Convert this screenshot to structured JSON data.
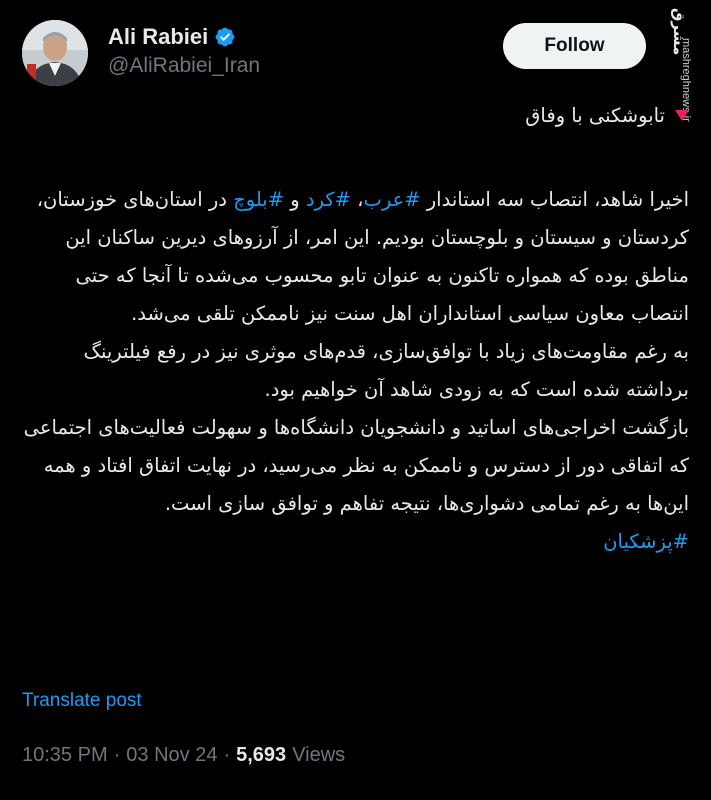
{
  "header": {
    "name": "Ali Rabiei",
    "handle": "@AliRabiei_Iran",
    "follow_label": "Follow",
    "verified": true
  },
  "watermark": {
    "logo": "مشرق",
    "site": "mashreghnews.ir"
  },
  "post": {
    "title": "تابوشکنی با وفاق",
    "paragraphs": [
      [
        "اخیرا شاهد، انتصاب سه استاندار ",
        {
          "tag": "#عرب"
        },
        "، ",
        {
          "tag": "#کرد"
        },
        " و ",
        {
          "tag": "#بلوچ"
        },
        " در استان‌های خوزستان، کردستان و سیستان و بلوچستان بودیم. این امر، از آرزوهای دیرین ساکنان این مناطق بوده که همواره تاکنون به عنوان تابو محسوب می‌شده تا آنجا که حتی انتصاب معاون سیاسی استانداران اهل سنت نیز ناممکن تلقی می‌شد."
      ],
      [
        "به رغم مقاومت‌های زیاد با توافق‌سازی، قدم‌های موثری نیز در رفع فیلترینگ  برداشته شده است که به زودی شاهد آن خواهیم بود."
      ],
      [
        "بازگشت اخراجی‌های اساتید و دانشجویان دانشگاه‌ها و سهولت فعالیت‌های اجتماعی که  اتفاقی دور از دسترس و ناممکن به نظر می‌رسید، در نهایت اتفاق افتاد و همه این‌ها به رغم تمامی دشواری‌ها، نتیجه تفاهم و توافق سازی است."
      ],
      [
        {
          "tag": "#پزشکیان"
        }
      ]
    ]
  },
  "translate_label": "Translate post",
  "meta": {
    "time": "10:35 PM",
    "date": "03 Nov 24",
    "views_count": "5,693",
    "views_label": "Views"
  },
  "colors": {
    "background": "#000000",
    "text": "#e7e9ea",
    "muted": "#71767b",
    "link": "#1d9bf0",
    "accent_triangle": "#e0245e"
  }
}
